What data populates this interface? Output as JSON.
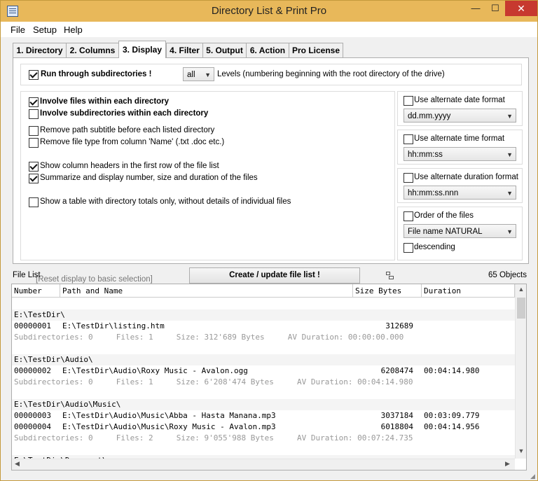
{
  "window": {
    "title": "Directory List & Print Pro",
    "min_symbol": "—",
    "max_symbol": "☐",
    "close_symbol": "✕",
    "accent": "#e8b85a",
    "close_color": "#c7392f"
  },
  "menu": [
    "File",
    "Setup",
    "Help"
  ],
  "tabs": [
    "1. Directory",
    "2. Columns",
    "3. Display",
    "4. Filter",
    "5. Output",
    "6. Action",
    "Pro License"
  ],
  "active_tab": "3. Display",
  "display": {
    "subdirs_label": "Run through subdirectories !",
    "levels_value": "all",
    "levels_text": "Levels  (numbering beginning with the root directory of the drive)",
    "options": [
      {
        "label": "Involve files within each directory",
        "checked": true
      },
      {
        "label": "Involve subdirectories within each directory",
        "checked": false
      },
      {
        "label": "Remove path subtitle before each listed directory",
        "checked": false
      },
      {
        "label": "Remove file type from column 'Name' (.txt .doc etc.)",
        "checked": false
      },
      {
        "label": "Show column headers in the first row of the file list",
        "checked": true
      },
      {
        "label": "Summarize and display number, size and duration of the files",
        "checked": true
      },
      {
        "label": "Show a table with directory totals only, without details of individual files",
        "checked": false
      }
    ],
    "reset_label": "[Reset display to basic selection]"
  },
  "formats": {
    "date_label": "Use alternate date format",
    "date_value": "dd.mm.yyyy",
    "time_label": "Use alternate time format",
    "time_value": "hh:mm:ss",
    "duration_label": "Use alternate duration format",
    "duration_value": "hh:mm:ss.nnn",
    "order_label": "Order of the files",
    "order_value": "File name NATURAL",
    "descending_label": "descending"
  },
  "statusbar": {
    "file_list_label": "File List",
    "create_button": "Create / update file list !",
    "objects_count": "65 Objects"
  },
  "file_list": {
    "headers": [
      "Number",
      "Path and Name",
      "Size Bytes",
      "Duration"
    ],
    "rows": [
      {
        "kind": "blank"
      },
      {
        "kind": "dir",
        "path": "E:\\TestDir\\"
      },
      {
        "kind": "file",
        "number": "00000001",
        "path": "E:\\TestDir\\listing.htm",
        "size": "312689",
        "duration": ""
      },
      {
        "kind": "sum",
        "text": "Subdirectories: 0     Files: 1     Size: 312'689 Bytes     AV Duration: 00:00:00.000"
      },
      {
        "kind": "blank"
      },
      {
        "kind": "dir",
        "path": "E:\\TestDir\\Audio\\"
      },
      {
        "kind": "file",
        "number": "00000002",
        "path": "E:\\TestDir\\Audio\\Roxy Music - Avalon.ogg",
        "size": "6208474",
        "duration": "00:04:14.980"
      },
      {
        "kind": "sum",
        "text": "Subdirectories: 0     Files: 1     Size: 6'208'474 Bytes     AV Duration: 00:04:14.980"
      },
      {
        "kind": "blank"
      },
      {
        "kind": "dir",
        "path": "E:\\TestDir\\Audio\\Music\\"
      },
      {
        "kind": "file",
        "number": "00000003",
        "path": "E:\\TestDir\\Audio\\Music\\Abba - Hasta Manana.mp3",
        "size": "3037184",
        "duration": "00:03:09.779"
      },
      {
        "kind": "file",
        "number": "00000004",
        "path": "E:\\TestDir\\Audio\\Music\\Roxy Music - Avalon.mp3",
        "size": "6018804",
        "duration": "00:04:14.956"
      },
      {
        "kind": "sum",
        "text": "Subdirectories: 0     Files: 2     Size: 9'055'988 Bytes     AV Duration: 00:07:24.735"
      },
      {
        "kind": "blank"
      },
      {
        "kind": "dir",
        "path": "E:\\TestDir\\Document\\"
      }
    ]
  }
}
